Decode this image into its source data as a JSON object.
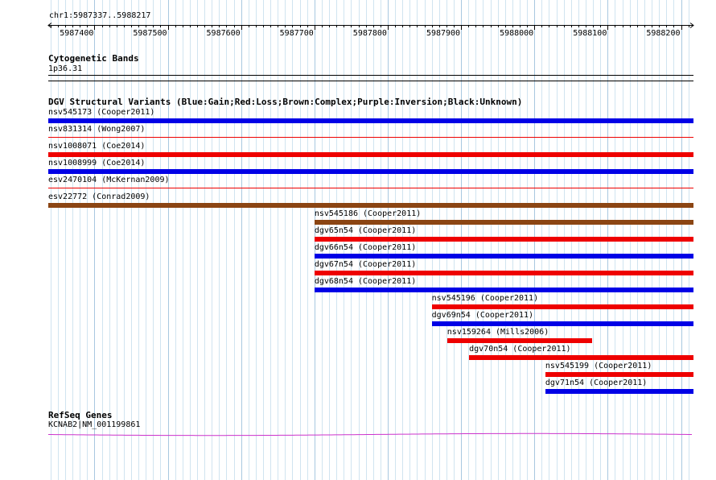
{
  "ruler": {
    "location": "chr1:5987337..5988217",
    "ticks": [
      {
        "pos": 5987400,
        "label": "5987400"
      },
      {
        "pos": 5987500,
        "label": "5987500"
      },
      {
        "pos": 5987600,
        "label": "5987600"
      },
      {
        "pos": 5987700,
        "label": "5987700"
      },
      {
        "pos": 5987800,
        "label": "5987800"
      },
      {
        "pos": 5987900,
        "label": "5987900"
      },
      {
        "pos": 5988000,
        "label": "5988000"
      },
      {
        "pos": 5988100,
        "label": "5988100"
      },
      {
        "pos": 5988200,
        "label": "5988200"
      }
    ],
    "start": 5987337,
    "end": 5988217
  },
  "cytoband": {
    "title": "Cytogenetic Bands",
    "band": "1p36.31"
  },
  "dgv": {
    "title": "DGV Structural Variants (Blue:Gain;Red:Loss;Brown:Complex;Purple:Inversion;Black:Unknown)",
    "colors": {
      "gain": "#0000e6",
      "loss": "#ee0000",
      "complex": "#8b4513",
      "unknown": "#000000"
    },
    "variants": [
      {
        "label": "nsv545173 (Cooper2011)",
        "start": 5987337,
        "end": 5988217,
        "type": "gain",
        "thin": false
      },
      {
        "label": "nsv831314 (Wong2007)",
        "start": 5987337,
        "end": 5988217,
        "type": "loss",
        "thin": true
      },
      {
        "label": "nsv1008071 (Coe2014)",
        "start": 5987337,
        "end": 5988217,
        "type": "loss",
        "thin": false
      },
      {
        "label": "nsv1008999 (Coe2014)",
        "start": 5987337,
        "end": 5988217,
        "type": "gain",
        "thin": false
      },
      {
        "label": "esv2470104 (McKernan2009)",
        "start": 5987337,
        "end": 5988217,
        "type": "loss",
        "thin": true
      },
      {
        "label": "esv22772 (Conrad2009)",
        "start": 5987337,
        "end": 5988217,
        "type": "complex",
        "thin": false
      },
      {
        "label": "nsv545186 (Cooper2011)",
        "start": 5987700,
        "end": 5988217,
        "type": "complex",
        "thin": false
      },
      {
        "label": "dgv65n54 (Cooper2011)",
        "start": 5987700,
        "end": 5988217,
        "type": "loss",
        "thin": false
      },
      {
        "label": "dgv66n54 (Cooper2011)",
        "start": 5987700,
        "end": 5988217,
        "type": "gain",
        "thin": false
      },
      {
        "label": "dgv67n54 (Cooper2011)",
        "start": 5987700,
        "end": 5988217,
        "type": "loss",
        "thin": false
      },
      {
        "label": "dgv68n54 (Cooper2011)",
        "start": 5987700,
        "end": 5988217,
        "type": "gain",
        "thin": false
      },
      {
        "label": "nsv545196 (Cooper2011)",
        "start": 5987860,
        "end": 5988217,
        "type": "loss",
        "thin": false
      },
      {
        "label": "dgv69n54 (Cooper2011)",
        "start": 5987860,
        "end": 5988217,
        "type": "gain",
        "thin": false
      },
      {
        "label": "nsv159264 (Mills2006)",
        "start": 5987881,
        "end": 5988079,
        "type": "loss",
        "thin": false
      },
      {
        "label": "dgv70n54 (Cooper2011)",
        "start": 5987911,
        "end": 5988217,
        "type": "loss",
        "thin": false
      },
      {
        "label": "nsv545199 (Cooper2011)",
        "start": 5988015,
        "end": 5988217,
        "type": "loss",
        "thin": false
      },
      {
        "label": "dgv71n54 (Cooper2011)",
        "start": 5988015,
        "end": 5988217,
        "type": "gain",
        "thin": false
      }
    ]
  },
  "refseq": {
    "title": "RefSeq Genes",
    "gene": "KCNAB2|NM_001199861",
    "color": "#cc33cc"
  }
}
